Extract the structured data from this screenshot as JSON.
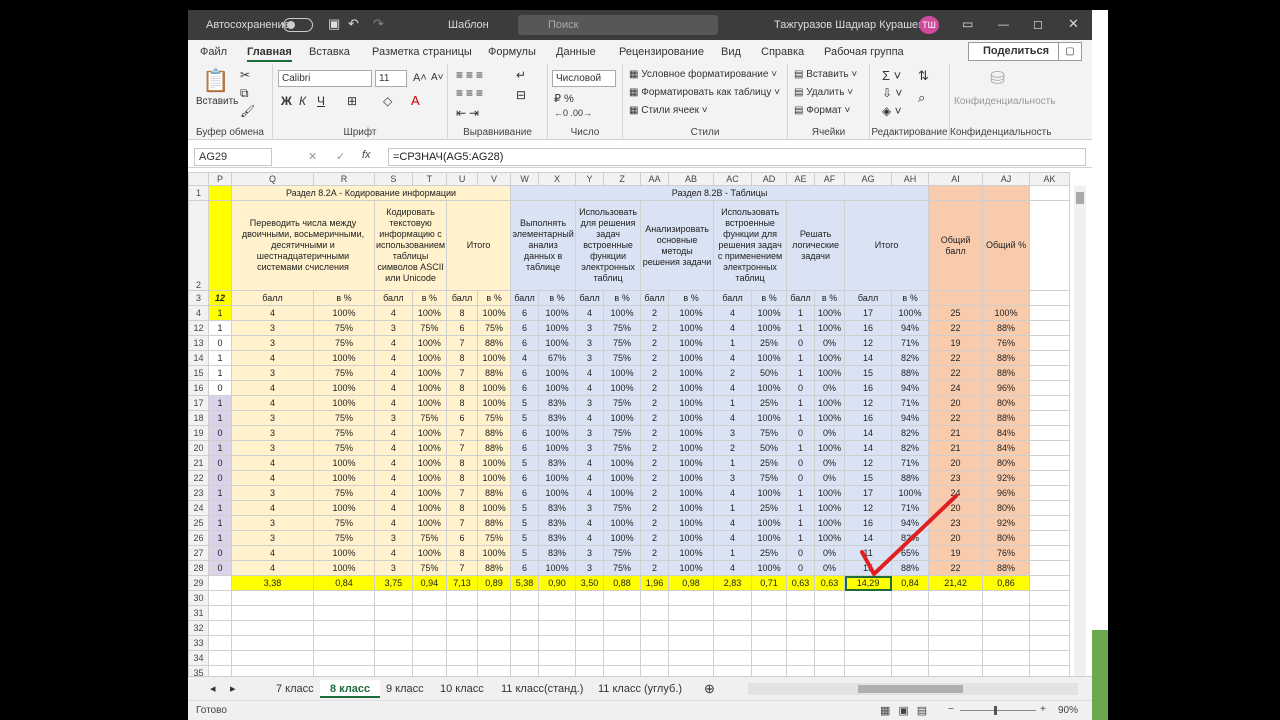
{
  "titlebar": {
    "autosave": "Автосохранение",
    "template": "Шаблон",
    "search": "Поиск",
    "user": "Тажгуразов Шадиар Курашевич",
    "initials": "ТШ"
  },
  "menu": [
    "Файл",
    "Главная",
    "Вставка",
    "Разметка страницы",
    "Формулы",
    "Данные",
    "Рецензирование",
    "Вид",
    "Справка",
    "Рабочая группа"
  ],
  "share": "Поделиться",
  "ribbon": {
    "paste": "Вставить",
    "clipboard": "Буфер обмена",
    "font_name": "Calibri",
    "font_size": "11",
    "font": "Шрифт",
    "bold": "Ж",
    "italic": "К",
    "underline": "Ч",
    "alignment": "Выравнивание",
    "num_format": "Числовой",
    "number": "Число",
    "cond_format": "Условное форматирование",
    "format_table": "Форматировать как таблицу",
    "cell_styles": "Стили ячеек",
    "styles": "Стили",
    "insert": "Вставить",
    "delete": "Удалить",
    "format": "Формат",
    "cells": "Ячейки",
    "editing": "Редактирование",
    "confidential": "Конфиденциальность",
    "confidential_group": "Конфиденциальность"
  },
  "formula_bar": {
    "cell": "AG29",
    "formula": "=СРЗНАЧ(AG5:AG28)"
  },
  "columns": [
    "P",
    "Q",
    "R",
    "S",
    "T",
    "U",
    "V",
    "W",
    "X",
    "Y",
    "Z",
    "AA",
    "AB",
    "AC",
    "AD",
    "AE",
    "AF",
    "AG",
    "AH",
    "AI",
    "AJ",
    "AK"
  ],
  "section_a": "Раздел 8.2А - Кодирование информации",
  "section_b": "Раздел 8.2В - Таблицы",
  "headers": {
    "h1": "Переводить числа между двоичными, восьмеричными, десятичными и шестнадцатеричными системами счисления",
    "h2": "Кодировать текстовую информацию с использованием таблицы символов ASCII или Unicode",
    "h3": "Итого",
    "h4": "Выполнять элементарный анализ данных в таблице",
    "h5": "Использовать для решения задач встроенные функции электронных таблиц",
    "h6": "Анализировать основные методы решения задачи",
    "h7": "Использовать встроенные функции для решения задач с применением электронных таблиц",
    "h8": "Решать логические задачи",
    "h9": "Итого",
    "total_score": "Общий балл",
    "total_pct": "Общий %"
  },
  "sub": {
    "p3": "12",
    "score": "балл",
    "pct": "в %"
  },
  "rows": [
    {
      "n": "4",
      "p": "1",
      "v": [
        "4",
        "100%",
        "4",
        "100%",
        "8",
        "100%",
        "6",
        "100%",
        "4",
        "100%",
        "2",
        "100%",
        "4",
        "100%",
        "1",
        "100%",
        "17",
        "100%",
        "25",
        "100%"
      ]
    },
    {
      "n": "12",
      "p": "1",
      "v": [
        "3",
        "75%",
        "3",
        "75%",
        "6",
        "75%",
        "6",
        "100%",
        "3",
        "75%",
        "2",
        "100%",
        "4",
        "100%",
        "1",
        "100%",
        "16",
        "94%",
        "22",
        "88%"
      ]
    },
    {
      "n": "13",
      "p": "0",
      "v": [
        "3",
        "75%",
        "4",
        "100%",
        "7",
        "88%",
        "6",
        "100%",
        "3",
        "75%",
        "2",
        "100%",
        "1",
        "25%",
        "0",
        "0%",
        "12",
        "71%",
        "19",
        "76%"
      ]
    },
    {
      "n": "14",
      "p": "1",
      "v": [
        "4",
        "100%",
        "4",
        "100%",
        "8",
        "100%",
        "4",
        "67%",
        "3",
        "75%",
        "2",
        "100%",
        "4",
        "100%",
        "1",
        "100%",
        "14",
        "82%",
        "22",
        "88%"
      ]
    },
    {
      "n": "15",
      "p": "1",
      "v": [
        "3",
        "75%",
        "4",
        "100%",
        "7",
        "88%",
        "6",
        "100%",
        "4",
        "100%",
        "2",
        "100%",
        "2",
        "50%",
        "1",
        "100%",
        "15",
        "88%",
        "22",
        "88%"
      ]
    },
    {
      "n": "16",
      "p": "0",
      "v": [
        "4",
        "100%",
        "4",
        "100%",
        "8",
        "100%",
        "6",
        "100%",
        "4",
        "100%",
        "2",
        "100%",
        "4",
        "100%",
        "0",
        "0%",
        "16",
        "94%",
        "24",
        "96%"
      ]
    },
    {
      "n": "17",
      "p": "1",
      "v": [
        "4",
        "100%",
        "4",
        "100%",
        "8",
        "100%",
        "5",
        "83%",
        "3",
        "75%",
        "2",
        "100%",
        "1",
        "25%",
        "1",
        "100%",
        "12",
        "71%",
        "20",
        "80%"
      ]
    },
    {
      "n": "18",
      "p": "1",
      "v": [
        "3",
        "75%",
        "3",
        "75%",
        "6",
        "75%",
        "5",
        "83%",
        "4",
        "100%",
        "2",
        "100%",
        "4",
        "100%",
        "1",
        "100%",
        "16",
        "94%",
        "22",
        "88%"
      ]
    },
    {
      "n": "19",
      "p": "0",
      "v": [
        "3",
        "75%",
        "4",
        "100%",
        "7",
        "88%",
        "6",
        "100%",
        "3",
        "75%",
        "2",
        "100%",
        "3",
        "75%",
        "0",
        "0%",
        "14",
        "82%",
        "21",
        "84%"
      ]
    },
    {
      "n": "20",
      "p": "1",
      "v": [
        "3",
        "75%",
        "4",
        "100%",
        "7",
        "88%",
        "6",
        "100%",
        "3",
        "75%",
        "2",
        "100%",
        "2",
        "50%",
        "1",
        "100%",
        "14",
        "82%",
        "21",
        "84%"
      ]
    },
    {
      "n": "21",
      "p": "0",
      "v": [
        "4",
        "100%",
        "4",
        "100%",
        "8",
        "100%",
        "5",
        "83%",
        "4",
        "100%",
        "2",
        "100%",
        "1",
        "25%",
        "0",
        "0%",
        "12",
        "71%",
        "20",
        "80%"
      ]
    },
    {
      "n": "22",
      "p": "0",
      "v": [
        "4",
        "100%",
        "4",
        "100%",
        "8",
        "100%",
        "6",
        "100%",
        "4",
        "100%",
        "2",
        "100%",
        "3",
        "75%",
        "0",
        "0%",
        "15",
        "88%",
        "23",
        "92%"
      ]
    },
    {
      "n": "23",
      "p": "1",
      "v": [
        "3",
        "75%",
        "4",
        "100%",
        "7",
        "88%",
        "6",
        "100%",
        "4",
        "100%",
        "2",
        "100%",
        "4",
        "100%",
        "1",
        "100%",
        "17",
        "100%",
        "24",
        "96%"
      ]
    },
    {
      "n": "24",
      "p": "1",
      "v": [
        "4",
        "100%",
        "4",
        "100%",
        "8",
        "100%",
        "5",
        "83%",
        "3",
        "75%",
        "2",
        "100%",
        "1",
        "25%",
        "1",
        "100%",
        "12",
        "71%",
        "20",
        "80%"
      ]
    },
    {
      "n": "25",
      "p": "1",
      "v": [
        "3",
        "75%",
        "4",
        "100%",
        "7",
        "88%",
        "5",
        "83%",
        "4",
        "100%",
        "2",
        "100%",
        "4",
        "100%",
        "1",
        "100%",
        "16",
        "94%",
        "23",
        "92%"
      ]
    },
    {
      "n": "26",
      "p": "1",
      "v": [
        "3",
        "75%",
        "3",
        "75%",
        "6",
        "75%",
        "5",
        "83%",
        "4",
        "100%",
        "2",
        "100%",
        "4",
        "100%",
        "1",
        "100%",
        "14",
        "82%",
        "20",
        "80%"
      ]
    },
    {
      "n": "27",
      "p": "0",
      "v": [
        "4",
        "100%",
        "4",
        "100%",
        "8",
        "100%",
        "5",
        "83%",
        "3",
        "75%",
        "2",
        "100%",
        "1",
        "25%",
        "0",
        "0%",
        "11",
        "65%",
        "19",
        "76%"
      ]
    },
    {
      "n": "28",
      "p": "0",
      "v": [
        "4",
        "100%",
        "3",
        "75%",
        "7",
        "88%",
        "6",
        "100%",
        "3",
        "75%",
        "2",
        "100%",
        "4",
        "100%",
        "0",
        "0%",
        "15",
        "88%",
        "22",
        "88%"
      ]
    }
  ],
  "avg": [
    "3,38",
    "0,84",
    "3,75",
    "0,94",
    "7,13",
    "0,89",
    "5,38",
    "0,90",
    "3,50",
    "0,88",
    "1,96",
    "0,98",
    "2,83",
    "0,71",
    "0,63",
    "0,63",
    "14,29",
    "0,84",
    "21,42",
    "0,86"
  ],
  "sheets": [
    "7 класс",
    "8 класс",
    "9 класс",
    "10 класс",
    "11 класс(станд.)",
    "11 класс (углуб.)"
  ],
  "status": {
    "ready": "Готово",
    "zoom": "90%"
  }
}
